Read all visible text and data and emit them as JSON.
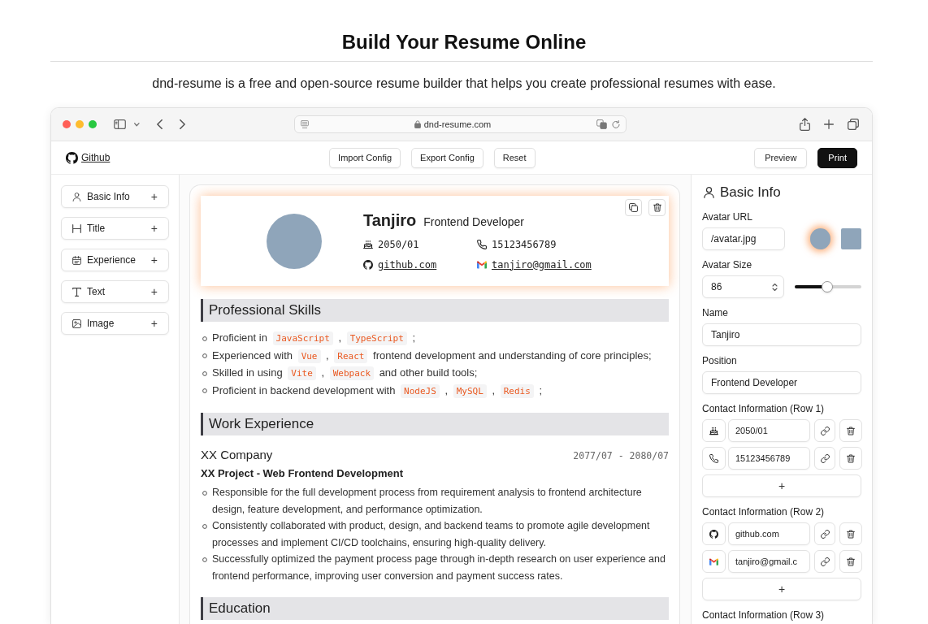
{
  "page": {
    "title": "Build Your Resume Online",
    "subtitle": "dnd-resume is a free and open-source resume builder that helps you create professional resumes with ease."
  },
  "browser": {
    "url": "dnd-resume.com"
  },
  "app_header": {
    "github_link": "Github",
    "actions": [
      "Import Config",
      "Export Config",
      "Reset"
    ],
    "right_actions": [
      {
        "label": "Preview",
        "kind": "outline"
      },
      {
        "label": "Print",
        "kind": "primary"
      }
    ]
  },
  "sidebar": {
    "items": [
      {
        "kind": "basic_info",
        "label": "Basic Info",
        "add": "+"
      },
      {
        "kind": "title",
        "label": "Title",
        "add": "+"
      },
      {
        "kind": "experience",
        "label": "Experience",
        "add": "+"
      },
      {
        "kind": "text",
        "label": "Text",
        "add": "+"
      },
      {
        "kind": "image",
        "label": "Image",
        "add": "+"
      }
    ]
  },
  "resume": {
    "header": {
      "selected": true,
      "name": "Tanjiro",
      "position": "Frontend Developer",
      "contacts": [
        {
          "kind": "birthday",
          "text": "2050/01",
          "link": false
        },
        {
          "kind": "phone",
          "text": "15123456789",
          "link": false
        },
        {
          "kind": "github",
          "text": "github.com",
          "link": true
        },
        {
          "kind": "gmail",
          "text": "tanjiro@gmail.com",
          "link": true
        }
      ]
    },
    "sections": [
      {
        "kind": "heading",
        "text": "Professional Skills"
      },
      {
        "kind": "list",
        "items": [
          {
            "segments": [
              {
                "kind": "text",
                "text": "Proficient in"
              },
              {
                "kind": "code",
                "text": "JavaScript"
              },
              {
                "kind": "text",
                "text": ","
              },
              {
                "kind": "code",
                "text": "TypeScript"
              },
              {
                "kind": "text",
                "text": ";"
              }
            ]
          },
          {
            "segments": [
              {
                "kind": "text",
                "text": "Experienced with"
              },
              {
                "kind": "code",
                "text": "Vue"
              },
              {
                "kind": "text",
                "text": ","
              },
              {
                "kind": "code",
                "text": "React"
              },
              {
                "kind": "text",
                "text": "frontend development and understanding of core principles;"
              }
            ]
          },
          {
            "segments": [
              {
                "kind": "text",
                "text": "Skilled in using"
              },
              {
                "kind": "code",
                "text": "Vite"
              },
              {
                "kind": "text",
                "text": ","
              },
              {
                "kind": "code",
                "text": "Webpack"
              },
              {
                "kind": "text",
                "text": "and other build tools;"
              }
            ]
          },
          {
            "segments": [
              {
                "kind": "text",
                "text": "Proficient in backend development with"
              },
              {
                "kind": "code",
                "text": "NodeJS"
              },
              {
                "kind": "text",
                "text": ","
              },
              {
                "kind": "code",
                "text": "MySQL"
              },
              {
                "kind": "text",
                "text": ","
              },
              {
                "kind": "code",
                "text": "Redis"
              },
              {
                "kind": "text",
                "text": ";"
              }
            ]
          }
        ]
      },
      {
        "kind": "heading",
        "text": "Work Experience"
      },
      {
        "kind": "experience",
        "company": "XX Company",
        "period": "2077/07 - 2080/07",
        "role": "XX Project - Web Frontend Development",
        "items": [
          "Responsible for the full development process from requirement analysis to frontend architecture design, feature development, and performance optimization.",
          "Consistently collaborated with product, design, and backend teams to promote agile development processes and implement CI/CD toolchains, ensuring high-quality delivery.",
          "Successfully optimized the payment process page through in-depth research on user experience and frontend performance, improving user conversion and payment success rates."
        ]
      },
      {
        "kind": "heading",
        "text": "Education"
      }
    ]
  },
  "editor": {
    "title": "Basic Info",
    "avatar_url": {
      "label": "Avatar URL",
      "value": "/avatar.jpg",
      "shapes": [
        {
          "kind": "circle",
          "selected": true
        },
        {
          "kind": "square",
          "selected": false
        }
      ]
    },
    "avatar_size": {
      "label": "Avatar Size",
      "value": "86",
      "level": 0.48
    },
    "fields": [
      {
        "label": "Name",
        "value": "Tanjiro"
      },
      {
        "label": "Position",
        "value": "Frontend Developer"
      }
    ],
    "contact_rows": [
      {
        "label": "Contact Information (Row 1)",
        "items": [
          {
            "kind": "birthday",
            "value": "2050/01"
          },
          {
            "kind": "phone",
            "value": "15123456789"
          }
        ],
        "add": "+"
      },
      {
        "label": "Contact Information (Row 2)",
        "items": [
          {
            "kind": "github",
            "value": "github.com"
          },
          {
            "kind": "gmail",
            "value": "tanjiro@gmail.c"
          }
        ],
        "add": "+"
      },
      {
        "label": "Contact Information (Row 3)"
      }
    ]
  }
}
